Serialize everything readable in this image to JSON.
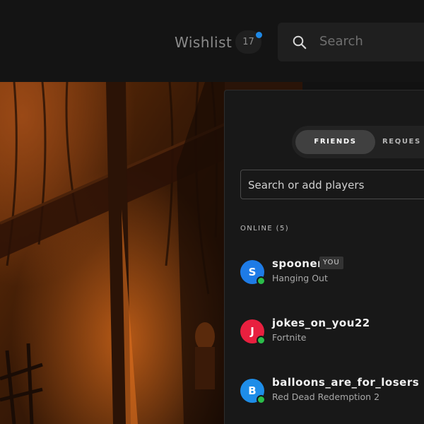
{
  "header": {
    "wishlist_label": "Wishlist",
    "wishlist_count": "17",
    "search_placeholder": "Search"
  },
  "friends_panel": {
    "tabs": [
      {
        "label": "FRIENDS",
        "active": true
      },
      {
        "label": "REQUES",
        "active": false
      }
    ],
    "search_placeholder": "Search or add players",
    "online_header": "ONLINE (5)",
    "friends": [
      {
        "initial": "S",
        "name": "spooner",
        "badge": "YOU",
        "status": "Hanging Out",
        "avatar_color": "#1e7be6"
      },
      {
        "initial": "J",
        "name": "jokes_on_you22",
        "status": "Fortnite",
        "avatar_color": "#e8203f"
      },
      {
        "initial": "B",
        "name": "balloons_are_for_losers",
        "status": "Red Dead Redemption 2",
        "avatar_color": "#1e8de8"
      }
    ]
  },
  "colors": {
    "accent_blue": "#1e88e5",
    "online_green": "#2bbd4a"
  }
}
